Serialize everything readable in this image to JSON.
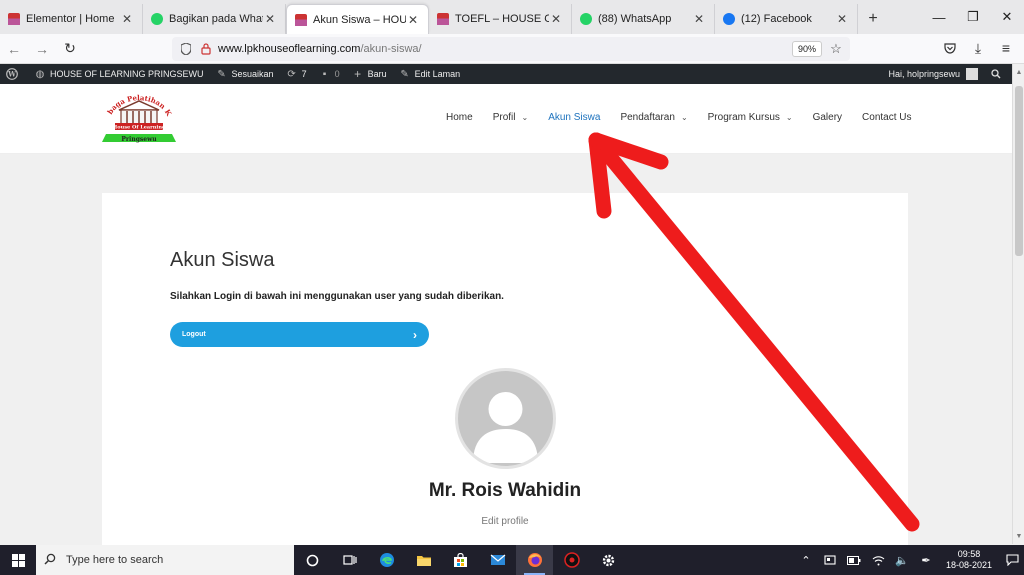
{
  "browser": {
    "tabs": [
      {
        "label": "Elementor | Home",
        "favicon": "house-logo-icon"
      },
      {
        "label": "Bagikan pada WhatsApp",
        "favicon": "whatsapp-icon"
      },
      {
        "label": "Akun Siswa – HOUSE OF LE",
        "favicon": "house-logo-icon",
        "active": true
      },
      {
        "label": "TOEFL – HOUSE OF LEARN",
        "favicon": "house-logo-icon"
      },
      {
        "label": "(88) WhatsApp",
        "favicon": "whatsapp-icon"
      },
      {
        "label": "(12) Facebook",
        "favicon": "facebook-icon"
      }
    ],
    "new_tab": "+",
    "window_controls": {
      "minimize": "—",
      "maximize": "❐",
      "close": "✕"
    },
    "url_domain": "www.lpkhouseoflearning.com",
    "url_path": "/akun-siswa/",
    "zoom": "90%"
  },
  "wp_admin_bar": {
    "site_name": "HOUSE OF LEARNING PRINGSEWU",
    "customize": "Sesuaikan",
    "updates_count": "7",
    "comments_count": "0",
    "new": "Baru",
    "edit_page": "Edit Laman",
    "greeting": "Hai, holpringsewu"
  },
  "site": {
    "logo_top_text": "Lembaga Pelatihan Kerja",
    "logo_mid_text": "House Of Learning",
    "logo_bottom_text": "Pringsewu",
    "menu": [
      {
        "label": "Home",
        "has_dropdown": false
      },
      {
        "label": "Profil",
        "has_dropdown": true
      },
      {
        "label": "Akun Siswa",
        "has_dropdown": false,
        "active": true
      },
      {
        "label": "Pendaftaran",
        "has_dropdown": true
      },
      {
        "label": "Program Kursus",
        "has_dropdown": true
      },
      {
        "label": "Galery",
        "has_dropdown": false
      },
      {
        "label": "Contact Us",
        "has_dropdown": false
      }
    ]
  },
  "content": {
    "title": "Akun Siswa",
    "intro": "Silahkan Login di bawah ini menggunakan user yang sudah diberikan.",
    "logout_label": "Logout",
    "profile_name": "Mr. Rois Wahidin",
    "edit_profile": "Edit profile"
  },
  "taskbar": {
    "search_placeholder": "Type here to search",
    "time": "09:58",
    "date": "18-08-2021"
  },
  "colors": {
    "accent_blue": "#1e9fdf",
    "menu_active": "#1e73be",
    "annotation_arrow": "#ee1c1c",
    "wp_bar": "#23282d"
  }
}
